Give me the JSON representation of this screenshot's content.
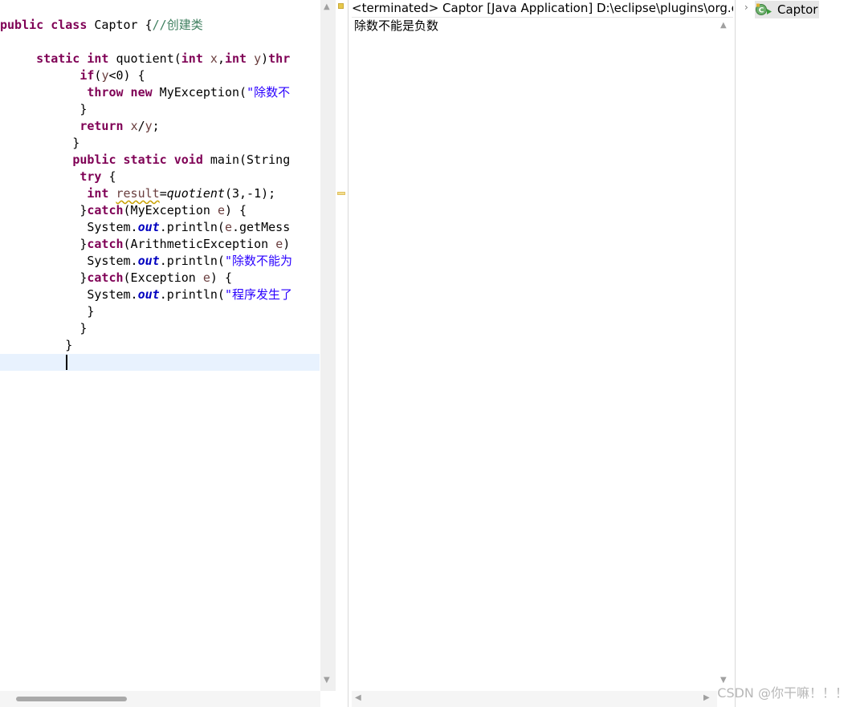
{
  "editor": {
    "lines": [
      [
        {
          "t": "public class",
          "c": "kw"
        },
        {
          "t": " Captor {"
        },
        {
          "t": "//创建类",
          "c": "cm"
        }
      ],
      [],
      [
        {
          "t": "     "
        },
        {
          "t": "static int",
          "c": "kw"
        },
        {
          "t": " quotient("
        },
        {
          "t": "int",
          "c": "kw"
        },
        {
          "t": " "
        },
        {
          "t": "x",
          "c": "pv"
        },
        {
          "t": ","
        },
        {
          "t": "int",
          "c": "kw"
        },
        {
          "t": " "
        },
        {
          "t": "y",
          "c": "pv"
        },
        {
          "t": ")"
        },
        {
          "t": "thr",
          "c": "kw"
        }
      ],
      [
        {
          "t": "           "
        },
        {
          "t": "if",
          "c": "kw"
        },
        {
          "t": "("
        },
        {
          "t": "y",
          "c": "pv"
        },
        {
          "t": "<0) {"
        }
      ],
      [
        {
          "t": "            "
        },
        {
          "t": "throw new",
          "c": "kw"
        },
        {
          "t": " MyException("
        },
        {
          "t": "\"除数不",
          "c": "st"
        }
      ],
      [
        {
          "t": "           }"
        }
      ],
      [
        {
          "t": "           "
        },
        {
          "t": "return",
          "c": "kw"
        },
        {
          "t": " "
        },
        {
          "t": "x",
          "c": "pv"
        },
        {
          "t": "/"
        },
        {
          "t": "y",
          "c": "pv"
        },
        {
          "t": ";"
        }
      ],
      [
        {
          "t": "          }"
        }
      ],
      [
        {
          "t": "          "
        },
        {
          "t": "public static void",
          "c": "kw"
        },
        {
          "t": " main(String"
        }
      ],
      [
        {
          "t": "           "
        },
        {
          "t": "try",
          "c": "kw"
        },
        {
          "t": " {"
        }
      ],
      [
        {
          "t": "            "
        },
        {
          "t": "int",
          "c": "kw"
        },
        {
          "t": " "
        },
        {
          "t": "result",
          "c": "wv"
        },
        {
          "t": "="
        },
        {
          "t": "quotient",
          "c": "it"
        },
        {
          "t": "(3,-1);"
        }
      ],
      [
        {
          "t": "           }"
        },
        {
          "t": "catch",
          "c": "kw"
        },
        {
          "t": "(MyException "
        },
        {
          "t": "e",
          "c": "pv"
        },
        {
          "t": ") {"
        }
      ],
      [
        {
          "t": "            System."
        },
        {
          "t": "out",
          "c": "fd"
        },
        {
          "t": ".println("
        },
        {
          "t": "e",
          "c": "pv"
        },
        {
          "t": ".getMess"
        }
      ],
      [
        {
          "t": "           }"
        },
        {
          "t": "catch",
          "c": "kw"
        },
        {
          "t": "(ArithmeticException "
        },
        {
          "t": "e",
          "c": "pv"
        },
        {
          "t": ")"
        }
      ],
      [
        {
          "t": "            System."
        },
        {
          "t": "out",
          "c": "fd"
        },
        {
          "t": ".println("
        },
        {
          "t": "\"除数不能为",
          "c": "st"
        }
      ],
      [
        {
          "t": "           }"
        },
        {
          "t": "catch",
          "c": "kw"
        },
        {
          "t": "(Exception "
        },
        {
          "t": "e",
          "c": "pv"
        },
        {
          "t": ") {"
        }
      ],
      [
        {
          "t": "            System."
        },
        {
          "t": "out",
          "c": "fd"
        },
        {
          "t": ".println("
        },
        {
          "t": "\"程序发生了",
          "c": "st"
        }
      ],
      [
        {
          "t": "            }"
        }
      ],
      [
        {
          "t": "           }"
        }
      ],
      [
        {
          "t": "         }"
        }
      ],
      []
    ]
  },
  "console": {
    "header": "<terminated> Captor [Java Application] D:\\eclipse\\plugins\\org.ec",
    "output": "除数不能是负数"
  },
  "outline": {
    "item_label": "Captor"
  },
  "watermark": "CSDN @你干嘛！！！",
  "colors": {
    "keyword": "#7f0055",
    "comment": "#3f7f5f",
    "string": "#2a00ff",
    "field": "#0000c0",
    "current_line": "#e8f2fe"
  }
}
